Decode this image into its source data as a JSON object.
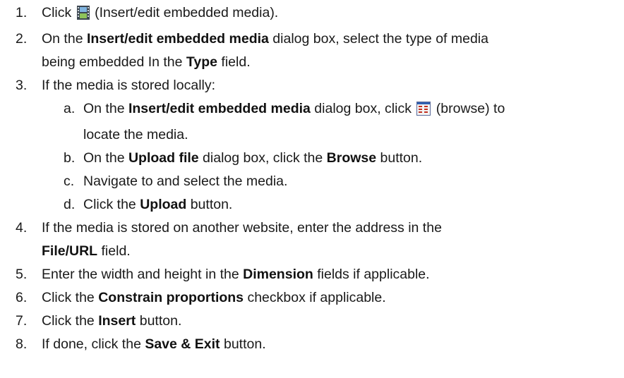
{
  "steps": [
    {
      "num": "1.",
      "t0": "Click ",
      "t1": " (Insert/edit embedded media)."
    },
    {
      "num": "2.",
      "t0": "On the ",
      "b0": "Insert/edit embedded media",
      "t1": " dialog box, select the type of media",
      "line2a": "being embedded In the ",
      "b1": "Type",
      "t2": " field."
    },
    {
      "num": "3.",
      "t0": "If the media is stored locally:"
    },
    {
      "num": "4.",
      "t0": "If the media is stored on another website, enter the address in the",
      "b0": "File/URL",
      "t1": " field."
    },
    {
      "num": "5.",
      "t0": "Enter the width and height in the ",
      "b0": "Dimension",
      "t1": " fields if applicable."
    },
    {
      "num": "6.",
      "t0": "Click the ",
      "b0": "Constrain proportions",
      "t1": " checkbox if applicable."
    },
    {
      "num": "7.",
      "t0": "Click the ",
      "b0": "Insert",
      "t1": " button."
    },
    {
      "num": "8.",
      "t0": "If done, click the ",
      "b0": "Save & Exit",
      "t1": " button."
    }
  ],
  "substeps": [
    {
      "num": "a.",
      "t0": "On the ",
      "b0": "Insert/edit embedded media",
      "t1": " dialog box, click ",
      "t2": " (browse) to",
      "line2": "locate the media."
    },
    {
      "num": "b.",
      "t0": "On the ",
      "b0": "Upload file",
      "t1": " dialog box, click the ",
      "b1": "Browse",
      "t2": " button."
    },
    {
      "num": "c.",
      "t0": "Navigate to and select the media."
    },
    {
      "num": "d.",
      "t0": "Click the ",
      "b0": "Upload",
      "t1": " button."
    }
  ],
  "icons": {
    "media": "film-strip-icon",
    "browse": "browse-grid-icon"
  }
}
